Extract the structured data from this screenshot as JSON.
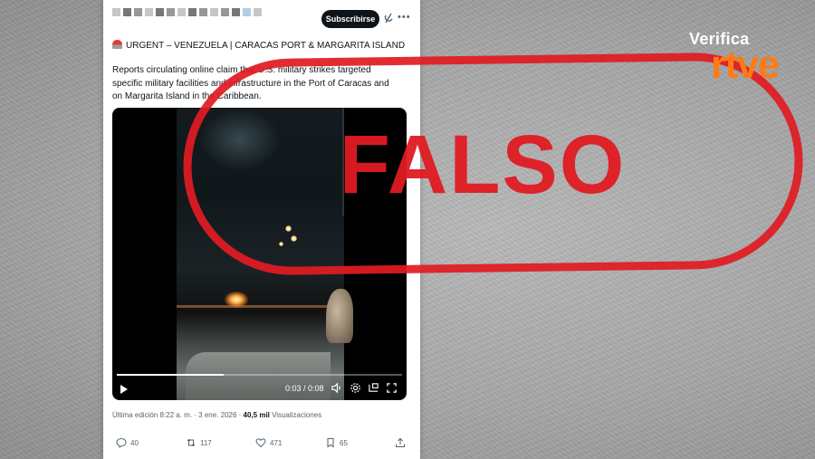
{
  "tweet": {
    "subscribe_label": "Subscribirse",
    "headline": "URGENT – VENEZUELA | CARACAS PORT & MARGARITA ISLAND",
    "body_line1": "Reports circulating online claim that U.S. military strikes targeted",
    "body_line2": "specific military facilities and infrastructure in the Port of Caracas and",
    "body_line3": "on Margarita Island in the Caribbean.",
    "video": {
      "time": "0:03 / 0:08",
      "progress": 0.375
    },
    "meta": {
      "edited": "Última edición 8:22 a. m. · 3 ene. 2026 · ",
      "views_count": "40,5 mil",
      "views_label": " Visualizaciones"
    },
    "actions": {
      "replies": "40",
      "reposts": "117",
      "likes": "471",
      "bookmarks": "65"
    }
  },
  "stamp": {
    "text": "FALSO",
    "color": "#e11b22"
  },
  "logo": {
    "line1": "Verifica",
    "line2": "rtve",
    "accent": "#ff7a12"
  }
}
